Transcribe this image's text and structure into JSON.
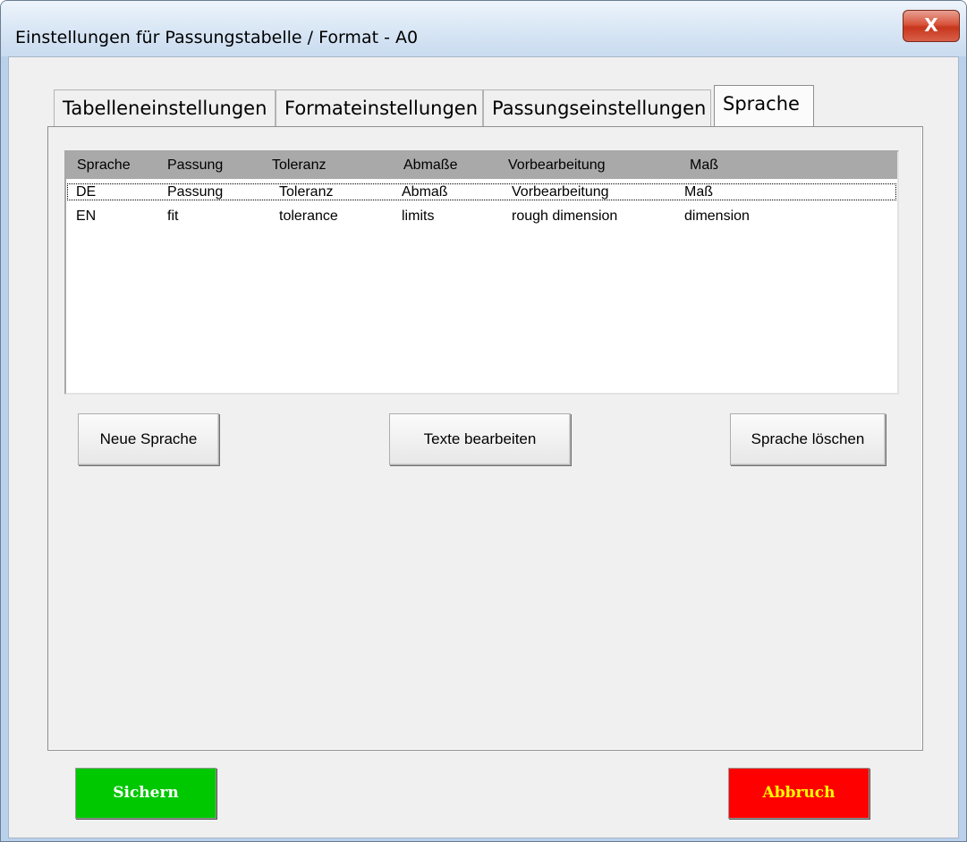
{
  "window": {
    "title": "Einstellungen für Passungstabelle / Format - A0",
    "close_label": "X"
  },
  "tabs": [
    {
      "label": "Tabelleneinstellungen",
      "active": false
    },
    {
      "label": "Formateinstellungen",
      "active": false
    },
    {
      "label": "Passungseinstellungen",
      "active": false
    },
    {
      "label": "Sprache",
      "active": true
    }
  ],
  "language_list": {
    "columns": [
      "Sprache",
      "Passung",
      "Toleranz",
      "Abmaße",
      "Vorbearbeitung",
      "Maß"
    ],
    "rows": [
      [
        "DE",
        "Passung",
        "Toleranz",
        "Abmaß",
        "Vorbearbeitung",
        "Maß"
      ],
      [
        "EN",
        "fit",
        "tolerance",
        "limits",
        "rough dimension",
        "dimension"
      ]
    ],
    "selected_row": 0
  },
  "actions": {
    "new_language": "Neue Sprache",
    "edit_texts": "Texte bearbeiten",
    "delete_language": "Sprache löschen"
  },
  "footer": {
    "save": {
      "label": "Sichern",
      "bg": "#00c800",
      "color": "#ffffff"
    },
    "cancel": {
      "label": "Abbruch",
      "bg": "#ff0000",
      "color": "#ffff00"
    }
  }
}
